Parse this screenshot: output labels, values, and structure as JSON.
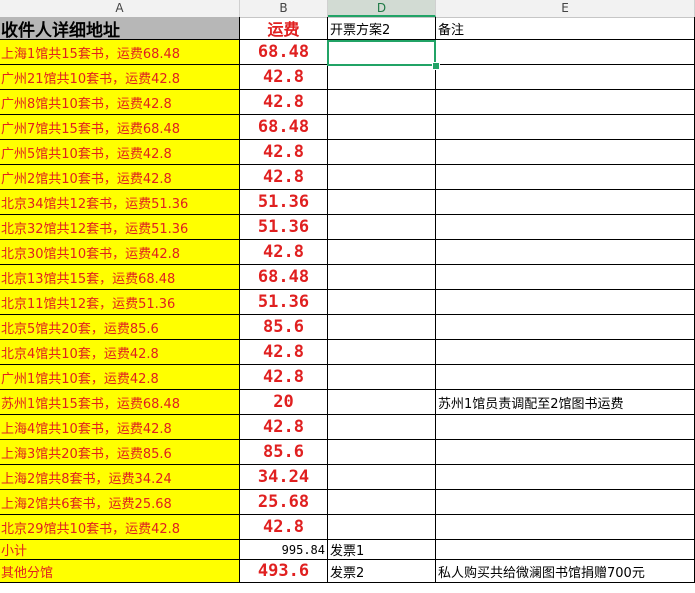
{
  "columns": [
    "A",
    "B",
    "D",
    "E"
  ],
  "selected_column": "D",
  "header_row": {
    "a": "收件人详细地址",
    "b": "运费",
    "d": "开票方案2",
    "e": "备注"
  },
  "rows": [
    {
      "a": "上海1馆共15套书，运费68.48",
      "b": "68.48",
      "d": "",
      "e": ""
    },
    {
      "a": "广州21馆共10套书，运费42.8",
      "b": "42.8",
      "d": "",
      "e": ""
    },
    {
      "a": "广州8馆共10套书，运费42.8",
      "b": "42.8",
      "d": "",
      "e": ""
    },
    {
      "a": "广州7馆共15套书，运费68.48",
      "b": "68.48",
      "d": "",
      "e": ""
    },
    {
      "a": "广州5馆共10套书，运费42.8",
      "b": "42.8",
      "d": "",
      "e": ""
    },
    {
      "a": "广州2馆共10套书，运费42.8",
      "b": "42.8",
      "d": "",
      "e": ""
    },
    {
      "a": "北京34馆共12套书，运费51.36",
      "b": "51.36",
      "d": "",
      "e": ""
    },
    {
      "a": "北京32馆共12套书，运费51.36",
      "b": "51.36",
      "d": "",
      "e": ""
    },
    {
      "a": "北京30馆共10套书，运费42.8",
      "b": "42.8",
      "d": "",
      "e": ""
    },
    {
      "a": "北京13馆共15套，运费68.48",
      "b": "68.48",
      "d": "",
      "e": ""
    },
    {
      "a": "北京11馆共12套，运费51.36",
      "b": "51.36",
      "d": "",
      "e": ""
    },
    {
      "a": "北京5馆共20套，运费85.6",
      "b": "85.6",
      "d": "",
      "e": ""
    },
    {
      "a": "北京4馆共10套，运费42.8",
      "b": "42.8",
      "d": "",
      "e": ""
    },
    {
      "a": "广州1馆共10套，运费42.8",
      "b": "42.8",
      "d": "",
      "e": ""
    },
    {
      "a": "苏州1馆共15套书，运费68.48",
      "b": "20",
      "d": "",
      "e": "苏州1馆员责调配至2馆图书运费"
    },
    {
      "a": "上海4馆共10套书，运费42.8",
      "b": "42.8",
      "d": "",
      "e": ""
    },
    {
      "a": "上海3馆共20套书，运费85.6",
      "b": "85.6",
      "d": "",
      "e": ""
    },
    {
      "a": "上海2馆共8套书，运费34.24",
      "b": "34.24",
      "d": "",
      "e": ""
    },
    {
      "a": "上海2馆共6套书，运费25.68",
      "b": "25.68",
      "d": "",
      "e": ""
    },
    {
      "a": "北京29馆共10套书，运费42.8",
      "b": "42.8",
      "d": "",
      "e": ""
    }
  ],
  "subtotal_row": {
    "a": "小计",
    "b": "995.84",
    "d": "发票1",
    "e": ""
  },
  "other_row": {
    "a": "其他分馆",
    "b": "493.6",
    "d": "发票2",
    "e": "私人购买共给微澜图书馆捐赠700元"
  },
  "colors": {
    "highlight": "#ffff00",
    "text_red": "#e02020",
    "selection": "#21a366"
  }
}
